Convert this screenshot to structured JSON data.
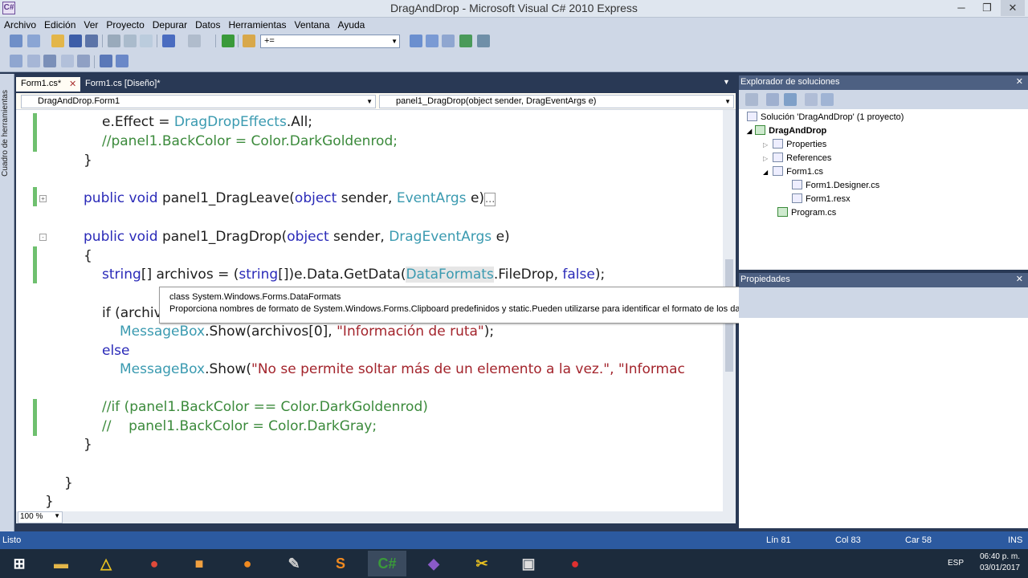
{
  "window": {
    "title": "DragAndDrop - Microsoft Visual C# 2010 Express",
    "icon_glyph": "C#",
    "min": "─",
    "max": "❐",
    "close": "✕"
  },
  "menu": [
    "Archivo",
    "Edición",
    "Ver",
    "Proyecto",
    "Depurar",
    "Datos",
    "Herramientas",
    "Ventana",
    "Ayuda"
  ],
  "toolbar": {
    "find_combo_value": "+="
  },
  "toolbox": {
    "label": "Cuadro de herramientas"
  },
  "tabs": [
    {
      "label": "Form1.cs*",
      "active": true,
      "close": "✕"
    },
    {
      "label": "Form1.cs [Diseño]*",
      "active": false
    }
  ],
  "nav": {
    "class_dropdown": "DragAndDrop.Form1",
    "member_dropdown": "panel1_DragDrop(object sender, DragEventArgs e)"
  },
  "code_tokens": {
    "l1a": "e.Effect = ",
    "l1b": "DragDropEffects",
    ".l1c": ".All;",
    "l2": "//panel1.BackColor = Color.DarkGoldenrod;",
    "brace_close": "}",
    "brace_open": "{",
    "l4a": "public void ",
    "l4b": "panel1_DragLeave(",
    "l4c": "object ",
    "l4d": "sender, ",
    "l4e": "EventArgs ",
    "l4f": "e)",
    "l4g": "...",
    "l5a": "public void ",
    "l5b": "panel1_DragDrop(",
    "l5c": "object ",
    "l5d": "sender, ",
    "l5e": "DragEventArgs ",
    "l5f": "e)",
    "l7a": "string",
    "l7b": "[] archivos = (",
    "l7c": "string",
    "l7d": "[])e.Data.GetData(",
    "l7e": "DataFormats",
    "l7f": ".FileDrop, ",
    "l7g": "false",
    "l7h": ");",
    "l8": "if (archiv",
    "l9a": "MessageBox",
    ".l9b": ".Show(archivos[0], ",
    "l9c": "\"Información de ruta\"",
    "l9d": ");",
    "l10": "else",
    "l11a": "MessageBox",
    ".l11b": ".Show(",
    "l11c": "\"No se permite soltar más de un elemento a la vez.\", \"Informac",
    "l12": "//if (panel1.BackColor == Color.DarkGoldenrod)",
    "l13": "//    panel1.BackColor = Color.DarkGray;"
  },
  "zoom": "100 %",
  "tooltip": {
    "line1": "class System.Windows.Forms.DataFormats",
    "line2": "Proporciona nombres de formato de System.Windows.Forms.Clipboard predefinidos y static.Pueden utilizarse para identificar el formato de los datos almacenados en un objeto System.Windows.Forms.IDataObject."
  },
  "solution_explorer": {
    "title": "Explorador de soluciones",
    "items": [
      {
        "label": "Solución 'DragAndDrop'  (1 proyecto)"
      },
      {
        "label": "DragAndDrop"
      },
      {
        "label": "Properties"
      },
      {
        "label": "References"
      },
      {
        "label": "Form1.cs"
      },
      {
        "label": "Form1.Designer.cs"
      },
      {
        "label": "Form1.resx"
      },
      {
        "label": "Program.cs"
      }
    ]
  },
  "properties": {
    "title": "Propiedades"
  },
  "status": {
    "left": "Listo",
    "line": "Lín 81",
    "col": "Col 83",
    "car": "Car 58",
    "ins": "INS"
  },
  "taskbar": {
    "lang": "ESP",
    "time": "06:40 p. m.",
    "date": "03/01/2017"
  }
}
